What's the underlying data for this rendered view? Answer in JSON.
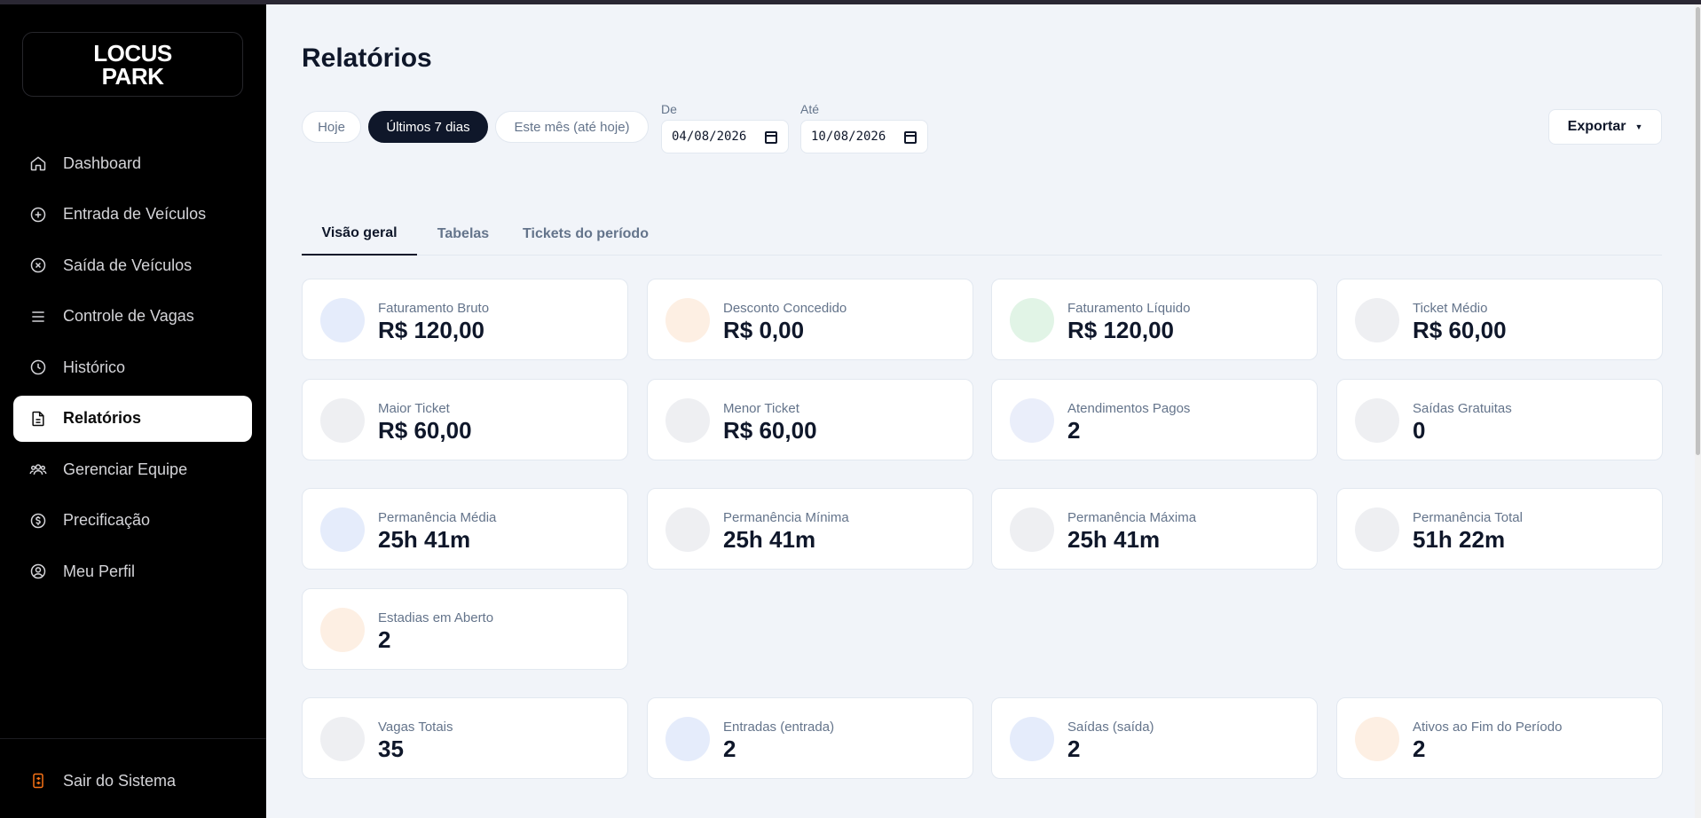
{
  "app": {
    "logo_line1": "LOCUS",
    "logo_line2": "PARK"
  },
  "sidebar": {
    "items": [
      {
        "label": "Dashboard",
        "icon": "home-icon"
      },
      {
        "label": "Entrada de Veículos",
        "icon": "plus-circle-icon"
      },
      {
        "label": "Saída de Veículos",
        "icon": "x-circle-icon"
      },
      {
        "label": "Controle de Vagas",
        "icon": "menu-icon"
      },
      {
        "label": "Histórico",
        "icon": "clock-icon"
      },
      {
        "label": "Relatórios",
        "icon": "file-text-icon",
        "active": true
      },
      {
        "label": "Gerenciar Equipe",
        "icon": "users-icon"
      },
      {
        "label": "Precificação",
        "icon": "dollar-circle-icon"
      },
      {
        "label": "Meu Perfil",
        "icon": "user-circle-icon"
      }
    ],
    "logout_label": "Sair do Sistema",
    "logout_icon": "logout-icon"
  },
  "main": {
    "title": "Relatórios",
    "filters": {
      "chips": [
        {
          "label": "Hoje",
          "active": false
        },
        {
          "label": "Últimos 7 dias",
          "active": true
        },
        {
          "label": "Este mês (até hoje)",
          "active": false
        }
      ],
      "from_label": "De",
      "from_value": "04/08/2026",
      "to_label": "Até",
      "to_value": "10/08/2026"
    },
    "export_label": "Exportar",
    "tabs": [
      {
        "label": "Visão geral",
        "active": true
      },
      {
        "label": "Tabelas",
        "active": false
      },
      {
        "label": "Tickets do período",
        "active": false
      }
    ],
    "cards": [
      {
        "label": "Faturamento Bruto",
        "value": "R$ 120,00",
        "color": "#e5ecfb"
      },
      {
        "label": "Desconto Concedido",
        "value": "R$ 0,00",
        "color": "#fdefe3"
      },
      {
        "label": "Faturamento Líquido",
        "value": "R$ 120,00",
        "color": "#e1f4e6"
      },
      {
        "label": "Ticket Médio",
        "value": "R$ 60,00",
        "color": "#eeeff2"
      },
      {
        "label": "Maior Ticket",
        "value": "R$ 60,00",
        "color": "#eeeff2"
      },
      {
        "label": "Menor Ticket",
        "value": "R$ 60,00",
        "color": "#eeeff2"
      },
      {
        "label": "Atendimentos Pagos",
        "value": "2",
        "color": "#eaeefa"
      },
      {
        "label": "Saídas Gratuitas",
        "value": "0",
        "color": "#eeeff2"
      },
      {
        "label": "Permanência Média",
        "value": "25h 41m",
        "color": "#e5ecfb"
      },
      {
        "label": "Permanência Mínima",
        "value": "25h 41m",
        "color": "#eeeff2"
      },
      {
        "label": "Permanência Máxima",
        "value": "25h 41m",
        "color": "#eeeff2"
      },
      {
        "label": "Permanência Total",
        "value": "51h 22m",
        "color": "#eeeff2"
      },
      {
        "label": "Estadias em Aberto",
        "value": "2",
        "color": "#fdefe3"
      },
      {
        "label": "Vagas Totais",
        "value": "35",
        "color": "#eeeff2"
      },
      {
        "label": "Entradas (entrada)",
        "value": "2",
        "color": "#e5ecfb"
      },
      {
        "label": "Saídas (saída)",
        "value": "2",
        "color": "#e5ecfb"
      },
      {
        "label": "Ativos ao Fim do Período",
        "value": "2",
        "color": "#fdefe3"
      }
    ]
  }
}
